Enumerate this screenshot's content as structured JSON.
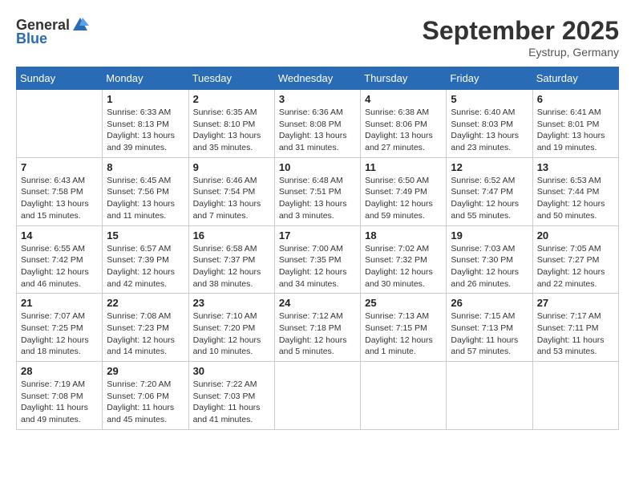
{
  "logo": {
    "general": "General",
    "blue": "Blue"
  },
  "title": "September 2025",
  "location": "Eystrup, Germany",
  "weekdays": [
    "Sunday",
    "Monday",
    "Tuesday",
    "Wednesday",
    "Thursday",
    "Friday",
    "Saturday"
  ],
  "weeks": [
    [
      {
        "day": null,
        "info": null
      },
      {
        "day": "1",
        "info": "Sunrise: 6:33 AM\nSunset: 8:13 PM\nDaylight: 13 hours\nand 39 minutes."
      },
      {
        "day": "2",
        "info": "Sunrise: 6:35 AM\nSunset: 8:10 PM\nDaylight: 13 hours\nand 35 minutes."
      },
      {
        "day": "3",
        "info": "Sunrise: 6:36 AM\nSunset: 8:08 PM\nDaylight: 13 hours\nand 31 minutes."
      },
      {
        "day": "4",
        "info": "Sunrise: 6:38 AM\nSunset: 8:06 PM\nDaylight: 13 hours\nand 27 minutes."
      },
      {
        "day": "5",
        "info": "Sunrise: 6:40 AM\nSunset: 8:03 PM\nDaylight: 13 hours\nand 23 minutes."
      },
      {
        "day": "6",
        "info": "Sunrise: 6:41 AM\nSunset: 8:01 PM\nDaylight: 13 hours\nand 19 minutes."
      }
    ],
    [
      {
        "day": "7",
        "info": "Sunrise: 6:43 AM\nSunset: 7:58 PM\nDaylight: 13 hours\nand 15 minutes."
      },
      {
        "day": "8",
        "info": "Sunrise: 6:45 AM\nSunset: 7:56 PM\nDaylight: 13 hours\nand 11 minutes."
      },
      {
        "day": "9",
        "info": "Sunrise: 6:46 AM\nSunset: 7:54 PM\nDaylight: 13 hours\nand 7 minutes."
      },
      {
        "day": "10",
        "info": "Sunrise: 6:48 AM\nSunset: 7:51 PM\nDaylight: 13 hours\nand 3 minutes."
      },
      {
        "day": "11",
        "info": "Sunrise: 6:50 AM\nSunset: 7:49 PM\nDaylight: 12 hours\nand 59 minutes."
      },
      {
        "day": "12",
        "info": "Sunrise: 6:52 AM\nSunset: 7:47 PM\nDaylight: 12 hours\nand 55 minutes."
      },
      {
        "day": "13",
        "info": "Sunrise: 6:53 AM\nSunset: 7:44 PM\nDaylight: 12 hours\nand 50 minutes."
      }
    ],
    [
      {
        "day": "14",
        "info": "Sunrise: 6:55 AM\nSunset: 7:42 PM\nDaylight: 12 hours\nand 46 minutes."
      },
      {
        "day": "15",
        "info": "Sunrise: 6:57 AM\nSunset: 7:39 PM\nDaylight: 12 hours\nand 42 minutes."
      },
      {
        "day": "16",
        "info": "Sunrise: 6:58 AM\nSunset: 7:37 PM\nDaylight: 12 hours\nand 38 minutes."
      },
      {
        "day": "17",
        "info": "Sunrise: 7:00 AM\nSunset: 7:35 PM\nDaylight: 12 hours\nand 34 minutes."
      },
      {
        "day": "18",
        "info": "Sunrise: 7:02 AM\nSunset: 7:32 PM\nDaylight: 12 hours\nand 30 minutes."
      },
      {
        "day": "19",
        "info": "Sunrise: 7:03 AM\nSunset: 7:30 PM\nDaylight: 12 hours\nand 26 minutes."
      },
      {
        "day": "20",
        "info": "Sunrise: 7:05 AM\nSunset: 7:27 PM\nDaylight: 12 hours\nand 22 minutes."
      }
    ],
    [
      {
        "day": "21",
        "info": "Sunrise: 7:07 AM\nSunset: 7:25 PM\nDaylight: 12 hours\nand 18 minutes."
      },
      {
        "day": "22",
        "info": "Sunrise: 7:08 AM\nSunset: 7:23 PM\nDaylight: 12 hours\nand 14 minutes."
      },
      {
        "day": "23",
        "info": "Sunrise: 7:10 AM\nSunset: 7:20 PM\nDaylight: 12 hours\nand 10 minutes."
      },
      {
        "day": "24",
        "info": "Sunrise: 7:12 AM\nSunset: 7:18 PM\nDaylight: 12 hours\nand 5 minutes."
      },
      {
        "day": "25",
        "info": "Sunrise: 7:13 AM\nSunset: 7:15 PM\nDaylight: 12 hours\nand 1 minute."
      },
      {
        "day": "26",
        "info": "Sunrise: 7:15 AM\nSunset: 7:13 PM\nDaylight: 11 hours\nand 57 minutes."
      },
      {
        "day": "27",
        "info": "Sunrise: 7:17 AM\nSunset: 7:11 PM\nDaylight: 11 hours\nand 53 minutes."
      }
    ],
    [
      {
        "day": "28",
        "info": "Sunrise: 7:19 AM\nSunset: 7:08 PM\nDaylight: 11 hours\nand 49 minutes."
      },
      {
        "day": "29",
        "info": "Sunrise: 7:20 AM\nSunset: 7:06 PM\nDaylight: 11 hours\nand 45 minutes."
      },
      {
        "day": "30",
        "info": "Sunrise: 7:22 AM\nSunset: 7:03 PM\nDaylight: 11 hours\nand 41 minutes."
      },
      {
        "day": null,
        "info": null
      },
      {
        "day": null,
        "info": null
      },
      {
        "day": null,
        "info": null
      },
      {
        "day": null,
        "info": null
      }
    ]
  ]
}
